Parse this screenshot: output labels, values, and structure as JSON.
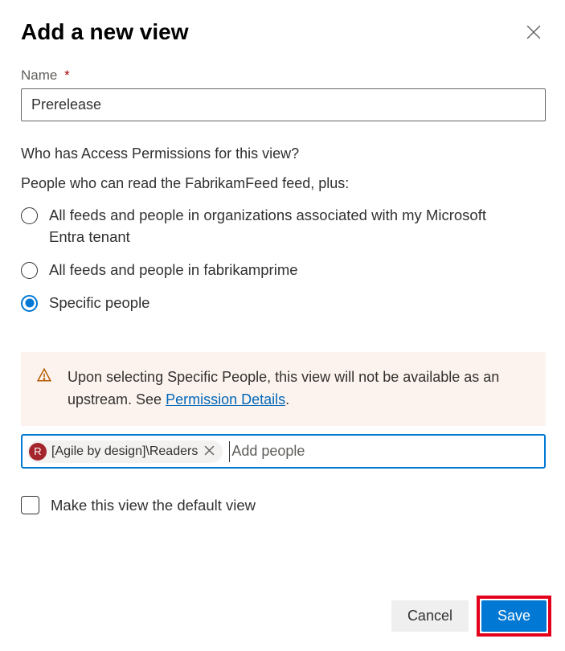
{
  "dialog": {
    "title": "Add a new view"
  },
  "fields": {
    "name": {
      "label": "Name",
      "required_marker": "*",
      "value": "Prerelease"
    }
  },
  "access": {
    "question": "Who has Access Permissions for this view?",
    "subtext": "People who can read the FabrikamFeed feed, plus:",
    "options": [
      {
        "label": "All feeds and people in organizations associated with my Microsoft Entra tenant",
        "selected": false
      },
      {
        "label": "All feeds and people in fabrikamprime",
        "selected": false
      },
      {
        "label": "Specific people",
        "selected": true
      }
    ]
  },
  "warning": {
    "text_before_link": "Upon selecting Specific People, this view will not be available as an upstream. See ",
    "link_text": "Permission Details",
    "text_after_link": "."
  },
  "people_picker": {
    "placeholder": "Add people",
    "chips": [
      {
        "avatar_initial": "R",
        "label": "[Agile by design]\\Readers"
      }
    ]
  },
  "default_view": {
    "label": "Make this view the default view",
    "checked": false
  },
  "footer": {
    "cancel": "Cancel",
    "save": "Save"
  }
}
